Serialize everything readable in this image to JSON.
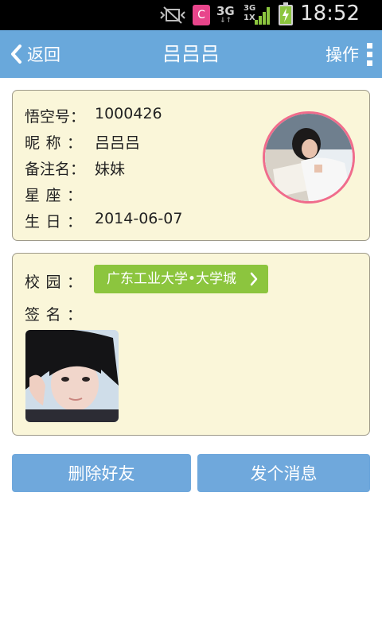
{
  "status_bar": {
    "time": "18:52",
    "notification_letter": "C",
    "network": "3G",
    "network_arrows": "↓↑",
    "signal_top": "3G",
    "signal_bottom": "1X"
  },
  "header": {
    "back_label": "返回",
    "title": "吕吕吕",
    "action_label": "操作"
  },
  "profile": {
    "rows": [
      {
        "key_chars": [
          "悟",
          "空",
          "号"
        ],
        "value": "1000426"
      },
      {
        "key_chars": [
          "昵",
          "称"
        ],
        "value": "吕吕吕"
      },
      {
        "key_chars": [
          "备",
          "注",
          "名"
        ],
        "value": "妹妹"
      },
      {
        "key_chars": [
          "星",
          "座"
        ],
        "value": ""
      },
      {
        "key_chars": [
          "生",
          "日"
        ],
        "value": "2014-06-07"
      }
    ],
    "colon": "："
  },
  "campus": {
    "label_chars": [
      "校",
      "园"
    ],
    "value": "广东工业大学•大学城",
    "signature_chars": [
      "签",
      "名"
    ]
  },
  "buttons": {
    "delete": "删除好友",
    "message": "发个消息"
  },
  "colors": {
    "title_bar": "#69a8db",
    "card_bg": "#faf6d9",
    "campus_tag": "#8cc53e",
    "avatar_border": "#f06c8c",
    "button": "#6fa8dc"
  }
}
